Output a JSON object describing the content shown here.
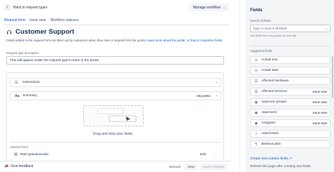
{
  "header": {
    "back_label": "Back to request types",
    "manage_label": "Manage workflow"
  },
  "tabs": [
    {
      "label": "Request form"
    },
    {
      "label": "Issue view"
    },
    {
      "label": "Workflow statuses"
    }
  ],
  "request_type": {
    "title": "Customer Support",
    "description_pre": "Fields added to the request form are filled out by customers when they raise a request from the portal. ",
    "description_link1": "Learn more about the portal",
    "description_mid": ", or ",
    "description_link2": "how to customize fields",
    "description_post": ".",
    "field_label": "Request type description",
    "field_value": "This will appear under the request type's name in the portal."
  },
  "form": {
    "instructions_label": "Instructions",
    "summary_label": "Summary",
    "summary_badge": "REQUIRED",
    "drop_text": "Drag and drop your fields",
    "attached_label": "Attached form",
    "attached_item": "Risk Questionnaire",
    "edit_label": "Edit"
  },
  "footer": {
    "feedback_label": "Give feedback",
    "discard_label": "Discard",
    "view_label": "View",
    "save_label": "Save changes"
  },
  "sidebar": {
    "title": "Fields",
    "search_label": "Search all fields",
    "search_placeholder": "Type to search all fields",
    "hint": "Use fields from any project on your site",
    "suggested_label": "Suggested fields",
    "items": [
      {
        "label": "Actual end",
        "icon": "clock-icon",
        "tag": ""
      },
      {
        "label": "Actual start",
        "icon": "clock-icon",
        "tag": ""
      },
      {
        "label": "Affected hardware",
        "icon": "list-icon",
        "tag": ""
      },
      {
        "label": "Affected services",
        "icon": "list-icon",
        "tag": "ISSUE VIEW"
      },
      {
        "label": "Approver groups",
        "icon": "people-icon",
        "tag": "ISSUE VIEW"
      },
      {
        "label": "Approvers",
        "icon": "person-icon",
        "tag": "ISSUE VIEW"
      },
      {
        "label": "Assignee",
        "icon": "person-icon",
        "tag": "ISSUE VIEW"
      },
      {
        "label": "Attachment",
        "icon": "paperclip-icon",
        "tag": ""
      },
      {
        "label": "Backout plan",
        "icon": "paragraph-icon",
        "tag": ""
      }
    ],
    "create_link": "Create new custom fields",
    "refresh_text": "Refresh this page after creating new fields."
  },
  "colors": {
    "accent": "#0052cc",
    "sidebar_bg": "#f4f5f7",
    "border": "#dfe1e6"
  }
}
